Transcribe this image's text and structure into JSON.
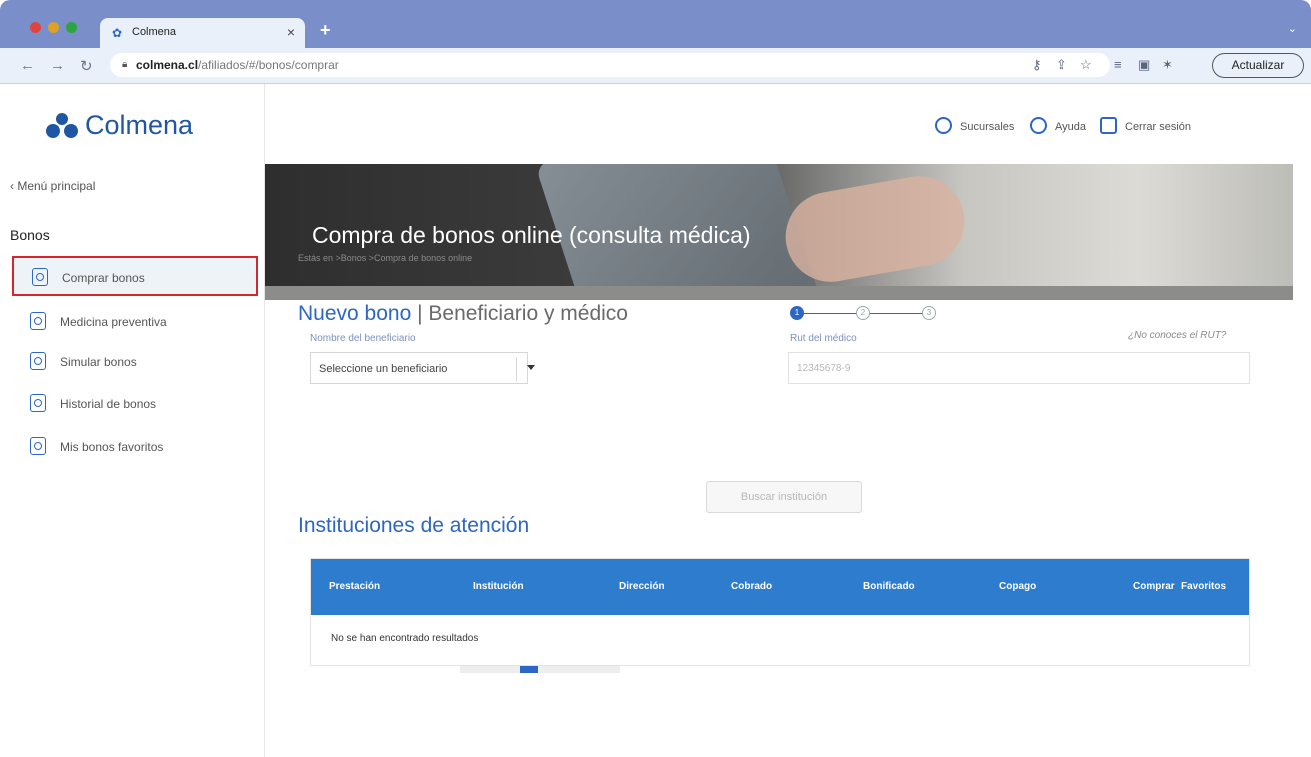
{
  "browser": {
    "tab_title": "Colmena",
    "url_host": "colmena.cl",
    "url_path": "/afiliados/#/bonos/comprar",
    "update_label": "Actualizar"
  },
  "brand": {
    "name": "Colmena",
    "primary_color": "#1f57a4",
    "accent_color": "#2d66c4",
    "highlight_color": "#d7262b"
  },
  "sidebar": {
    "back_label": "‹ Menú principal",
    "section_title": "Bonos",
    "items": [
      {
        "label": "Comprar bonos",
        "icon": "doc-search-icon",
        "active": true
      },
      {
        "label": "Medicina preventiva",
        "icon": "medical-doc-icon"
      },
      {
        "label": "Simular bonos",
        "icon": "simulate-icon"
      },
      {
        "label": "Historial de bonos",
        "icon": "history-icon"
      },
      {
        "label": "Mis bonos favoritos",
        "icon": "favorites-icon"
      }
    ]
  },
  "header": {
    "branches_label": "Sucursales",
    "help_label": "Ayuda",
    "logout_label": "Cerrar sesión"
  },
  "hero": {
    "title": "Compra de bonos online (consulta médica)"
  },
  "breadcrumb": "Estás en >Bonos >Compra de bonos online",
  "form": {
    "title_main": "Nuevo bono",
    "title_sep": " | ",
    "title_sub": "Beneficiario y médico",
    "beneficiary_label": "Nombre del beneficiario",
    "beneficiary_value": "Seleccione un beneficiario",
    "rut_label": "Rut del médico",
    "rut_placeholder": "12345678-9",
    "help_link": "¿No conoces el RUT?",
    "steps": [
      "1",
      "2",
      "3"
    ],
    "search_button": "Buscar institución"
  },
  "institutions": {
    "title": "Instituciones de atención",
    "columns": [
      "Prestación",
      "Institución",
      "Dirección",
      "Cobrado",
      "Bonificado",
      "Copago",
      "Comprar",
      "Favoritos"
    ],
    "empty_message": "No se han encontrado resultados"
  }
}
